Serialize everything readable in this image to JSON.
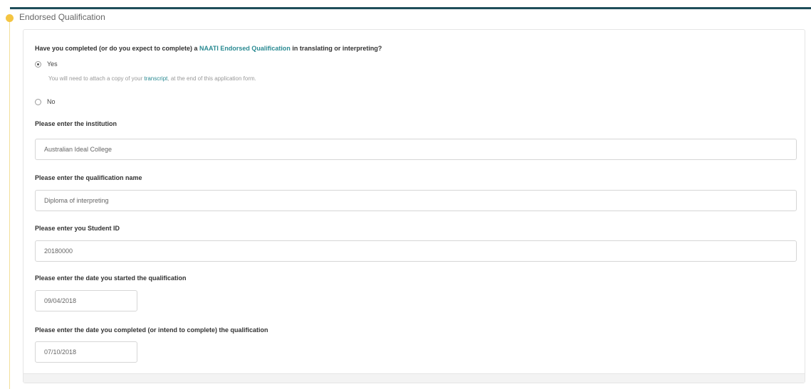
{
  "section": {
    "title": "Endorsed Qualification"
  },
  "question": {
    "prefix": "Have you completed (or do you expect to complete) a ",
    "link": "NAATI Endorsed Qualification",
    "suffix": " in translating or interpreting?"
  },
  "options": {
    "yes_label": "Yes",
    "no_label": "No",
    "selected": "Yes"
  },
  "hint": {
    "prefix": "You will need to attach a copy of your ",
    "link": "transcript",
    "suffix": ", at the end of this application form."
  },
  "fields": {
    "institution": {
      "label": "Please enter the institution",
      "value": "Australian Ideal College"
    },
    "qualification": {
      "label": "Please enter the qualification name",
      "value": "Diploma of interpreting"
    },
    "student_id": {
      "label": "Please enter you Student ID",
      "value": "20180000"
    },
    "start_date": {
      "label": "Please enter the date you started the qualification",
      "value": "09/04/2018"
    },
    "end_date": {
      "label": "Please enter the date you completed (or intend to complete) the qualification",
      "value": "07/10/2018"
    }
  },
  "colors": {
    "accent": "#2a8a92",
    "topline": "#1f4e5a",
    "marker": "#f4c542"
  }
}
